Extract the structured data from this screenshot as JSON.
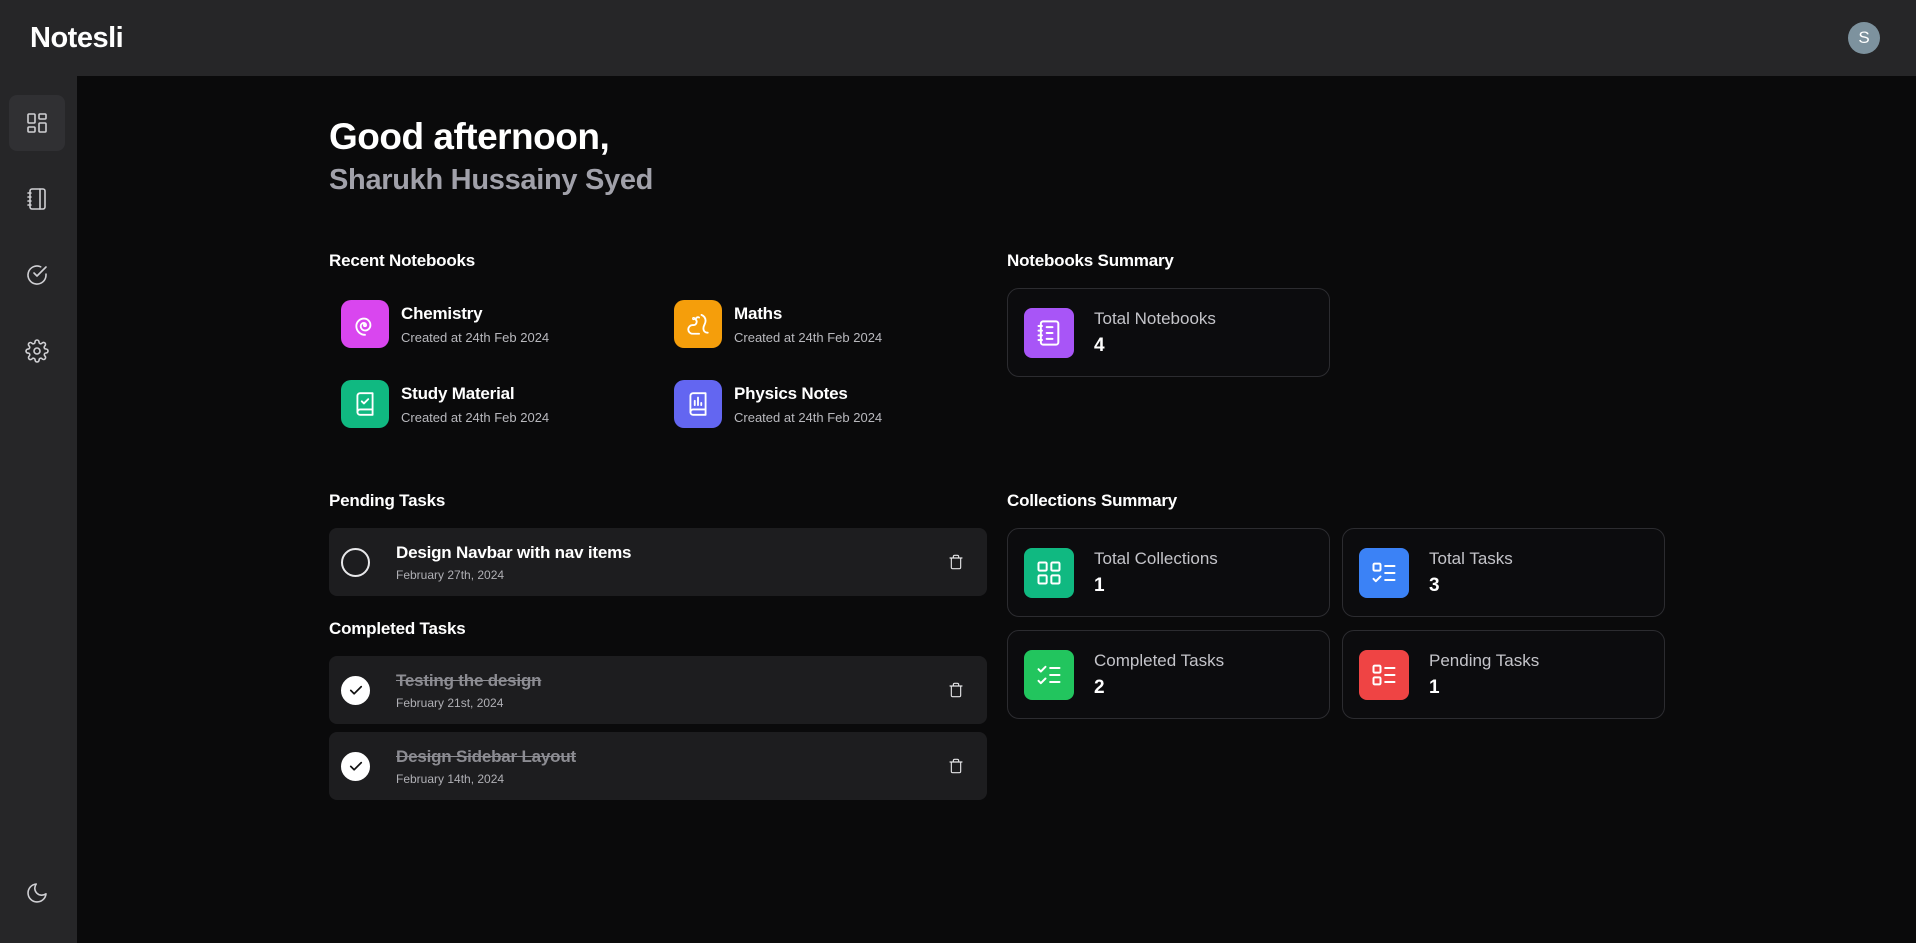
{
  "app": {
    "brand": "Notesli",
    "avatar_initial": "S"
  },
  "sidebar": {
    "items": [
      {
        "name": "dashboard",
        "icon": "dashboard-icon",
        "active": true
      },
      {
        "name": "notebooks",
        "icon": "notebook-icon",
        "active": false
      },
      {
        "name": "tasks",
        "icon": "check-circle-icon",
        "active": false
      },
      {
        "name": "settings",
        "icon": "gear-icon",
        "active": false
      }
    ],
    "theme_toggle_icon": "moon-icon"
  },
  "header": {
    "greeting": "Good afternoon,",
    "username": "Sharukh Hussainy Syed"
  },
  "recent_notebooks": {
    "title": "Recent Notebooks",
    "items": [
      {
        "name": "Chemistry",
        "date": "Created at 24th Feb 2024",
        "icon": "spiral-icon",
        "color": "#d946ef"
      },
      {
        "name": "Maths",
        "date": "Created at 24th Feb 2024",
        "icon": "squirrel-icon",
        "color": "#f59e0b"
      },
      {
        "name": "Study Material",
        "date": "Created at 24th Feb 2024",
        "icon": "book-check-icon",
        "color": "#10b981"
      },
      {
        "name": "Physics Notes",
        "date": "Created at 24th Feb 2024",
        "icon": "book-chart-icon",
        "color": "#6366f1"
      }
    ]
  },
  "notebooks_summary": {
    "title": "Notebooks Summary",
    "cards": [
      {
        "label": "Total Notebooks",
        "value": "4",
        "icon": "notebook-icon",
        "color": "#a855f7"
      }
    ]
  },
  "pending_tasks": {
    "title": "Pending Tasks",
    "items": [
      {
        "title": "Design Navbar with nav items",
        "date": "February 27th, 2024",
        "completed": false
      }
    ]
  },
  "completed_tasks": {
    "title": "Completed Tasks",
    "items": [
      {
        "title": "Testing the design",
        "date": "February 21st, 2024",
        "completed": true
      },
      {
        "title": "Design Sidebar Layout",
        "date": "February 14th, 2024",
        "completed": true
      }
    ]
  },
  "collections_summary": {
    "title": "Collections Summary",
    "cards": [
      {
        "label": "Total Collections",
        "value": "1",
        "icon": "grid-icon",
        "color": "#10b981"
      },
      {
        "label": "Total Tasks",
        "value": "3",
        "icon": "list-check-icon",
        "color": "#3b82f6"
      },
      {
        "label": "Completed Tasks",
        "value": "2",
        "icon": "list-checks-icon",
        "color": "#22c55e"
      },
      {
        "label": "Pending Tasks",
        "value": "1",
        "icon": "list-todo-icon",
        "color": "#ef4444"
      }
    ]
  }
}
